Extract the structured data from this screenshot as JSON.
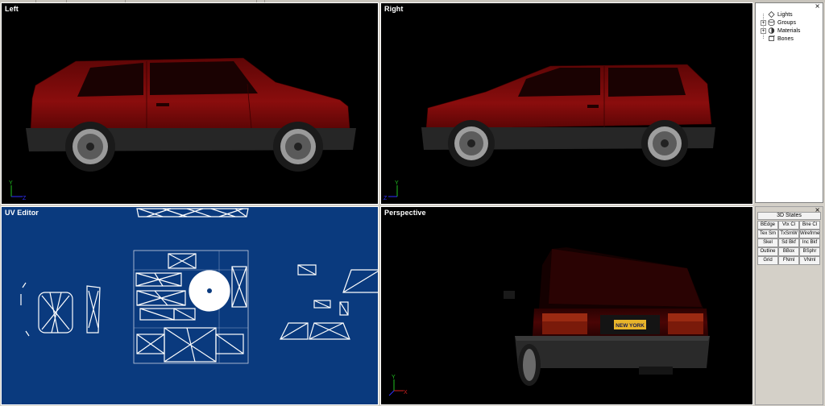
{
  "viewports": {
    "left": {
      "title": "Left"
    },
    "right": {
      "title": "Right"
    },
    "uv": {
      "title": "UV Editor"
    },
    "perspective": {
      "title": "Perspective"
    }
  },
  "car": {
    "license_plate": "NEW YORK",
    "body_color": "#7a0a0a",
    "bumper_color": "#2a2a2a"
  },
  "uv_background": "#0a3a7e",
  "axes": {
    "y": "Y",
    "z": "Z",
    "x": "X"
  },
  "scene_tree": {
    "close": "×",
    "items": [
      {
        "label": "Lights",
        "icon": "light-icon",
        "expandable": false
      },
      {
        "label": "Groups",
        "icon": "group-icon",
        "expandable": true
      },
      {
        "label": "Materials",
        "icon": "material-icon",
        "expandable": true
      },
      {
        "label": "Bones",
        "icon": "bone-icon",
        "expandable": false
      }
    ]
  },
  "states_panel": {
    "close": "×",
    "title": "3D States",
    "buttons": [
      "BEdge",
      "Vtx Cl",
      "Bne Cl",
      "Tex Sm",
      "TxSmW",
      "Wirefrme",
      "Skel",
      "Sd Bkf",
      "Inc Bkf",
      "Outline",
      "BBox",
      "BSphr",
      "Grid",
      "FNml",
      "VNml"
    ]
  }
}
